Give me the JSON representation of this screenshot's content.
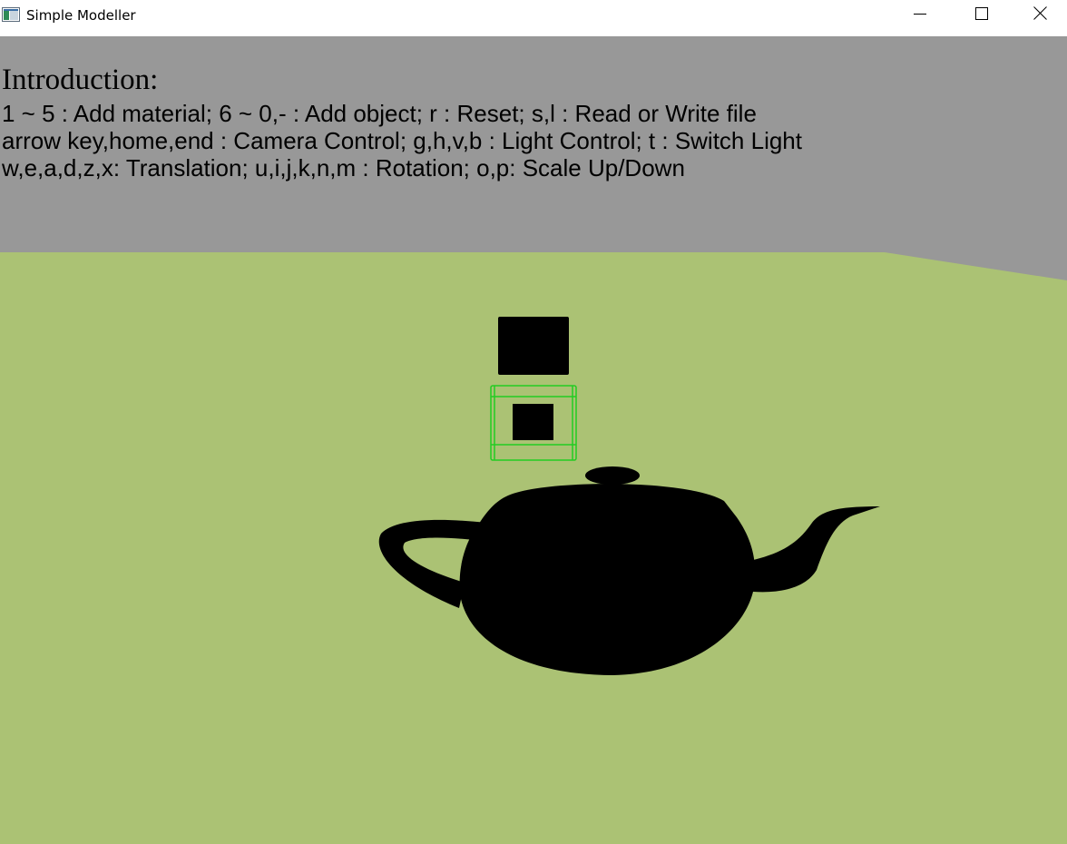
{
  "window": {
    "title": "Simple Modeller",
    "app_icon": "opengl-window-icon",
    "controls": {
      "minimize_icon": "minimize-icon",
      "maximize_icon": "maximize-icon",
      "close_icon": "close-icon"
    }
  },
  "overlay": {
    "heading": "Introduction:",
    "lines": [
      "1 ~ 5 : Add material; 6 ~ 0,- : Add object; r : Reset; s,l : Read or Write file",
      "arrow key,home,end : Camera Control; g,h,v,b : Light Control; t : Switch Light",
      "w,e,a,d,z,x: Translation; u,i,j,k,n,m : Rotation; o,p: Scale Up/Down"
    ]
  },
  "scene": {
    "colors": {
      "sky": "#989898",
      "ground": "#abc274",
      "objects": "#000000",
      "selection": "#22cc22"
    },
    "objects": [
      "cube",
      "selected-cube",
      "teapot"
    ]
  }
}
